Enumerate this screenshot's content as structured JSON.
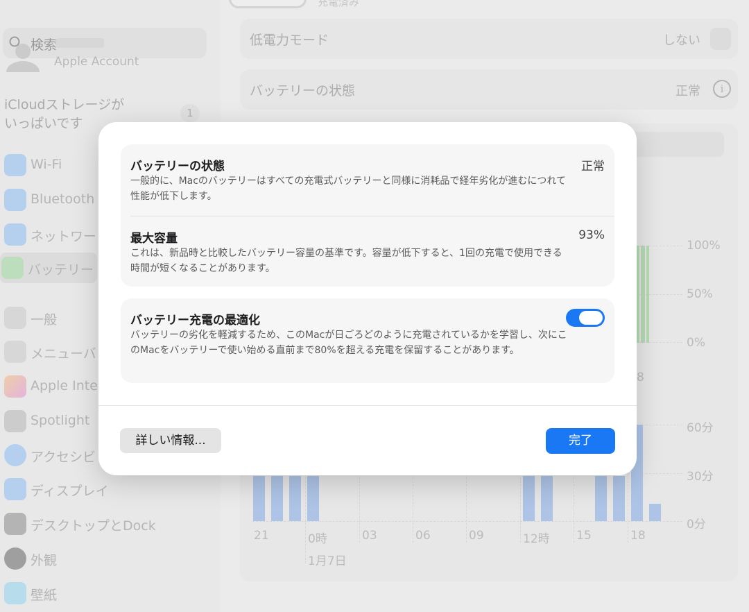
{
  "sidebar": {
    "search_placeholder": "検索",
    "account_sub": "Apple Account",
    "icloud_notice_line1": "iCloudストレージが",
    "icloud_notice_line2": "いっぱいです",
    "icloud_badge": "1",
    "items": [
      {
        "label": "Wi-Fi",
        "icon": "wifi-icon",
        "color": "#3a8ef6"
      },
      {
        "label": "Bluetooth",
        "icon": "bluetooth-icon",
        "color": "#3a8ef6"
      },
      {
        "label": "ネットワー",
        "icon": "globe-icon",
        "color": "#3a8ef6"
      },
      {
        "label": "バッテリー",
        "icon": "battery-icon",
        "color": "#4cc25a"
      },
      {
        "label": "一般",
        "icon": "gear-icon",
        "color": "#9a9a9a"
      },
      {
        "label": "メニューバ",
        "icon": "menubar-icon",
        "color": "#9a9a9a"
      },
      {
        "label": "Apple Inte",
        "icon": "apple-intelligence-icon",
        "color": "#e8a24c"
      },
      {
        "label": "Spotlight",
        "icon": "search-icon",
        "color": "#7a7a7a"
      },
      {
        "label": "アクセシビ",
        "icon": "accessibility-icon",
        "color": "#3a8ef6"
      },
      {
        "label": "ディスプレイ",
        "icon": "display-icon",
        "color": "#3a8ef6"
      },
      {
        "label": "デスクトップとDock",
        "icon": "dock-icon",
        "color": "#555555"
      },
      {
        "label": "外観",
        "icon": "appearance-icon",
        "color": "#333333"
      },
      {
        "label": "壁紙",
        "icon": "wallpaper-icon",
        "color": "#3ab8e8"
      }
    ]
  },
  "main": {
    "top_fade": "充電済み",
    "low_power": {
      "label": "低電力モード",
      "value": "しない"
    },
    "health": {
      "label": "バッテリーの状態",
      "value": "正常"
    },
    "chart": {
      "level_ticks": [
        "100%",
        "50%",
        "0%"
      ],
      "usage_ticks": [
        "60分",
        "30分",
        "0分"
      ],
      "x_labels": [
        "21",
        "0時",
        "03",
        "06",
        "09",
        "12時",
        "15",
        "18"
      ],
      "date_label": "1月7日",
      "stray_label": "8"
    }
  },
  "modal": {
    "health": {
      "title": "バッテリーの状態",
      "value": "正常",
      "desc": "一般的に、Macのバッテリーはすべての充電式バッテリーと同様に消耗品で経年劣化が進むにつれて性能が低下します。"
    },
    "capacity": {
      "title": "最大容量",
      "value": "93%",
      "desc": "これは、新品時と比較したバッテリー容量の基準です。容量が低下すると、1回の充電で使用できる時間が短くなることがあります。"
    },
    "optimize": {
      "title": "バッテリー充電の最適化",
      "enabled": true,
      "desc": "バッテリーの劣化を軽減するため、このMacが日ごろどのように充電されているかを学習し、次にこのMacをバッテリーで使い始める直前まで80%を超える充電を保留することがあります。"
    },
    "more_button": "詳しい情報...",
    "done_button": "完了",
    "accent": "#1a78f5"
  }
}
